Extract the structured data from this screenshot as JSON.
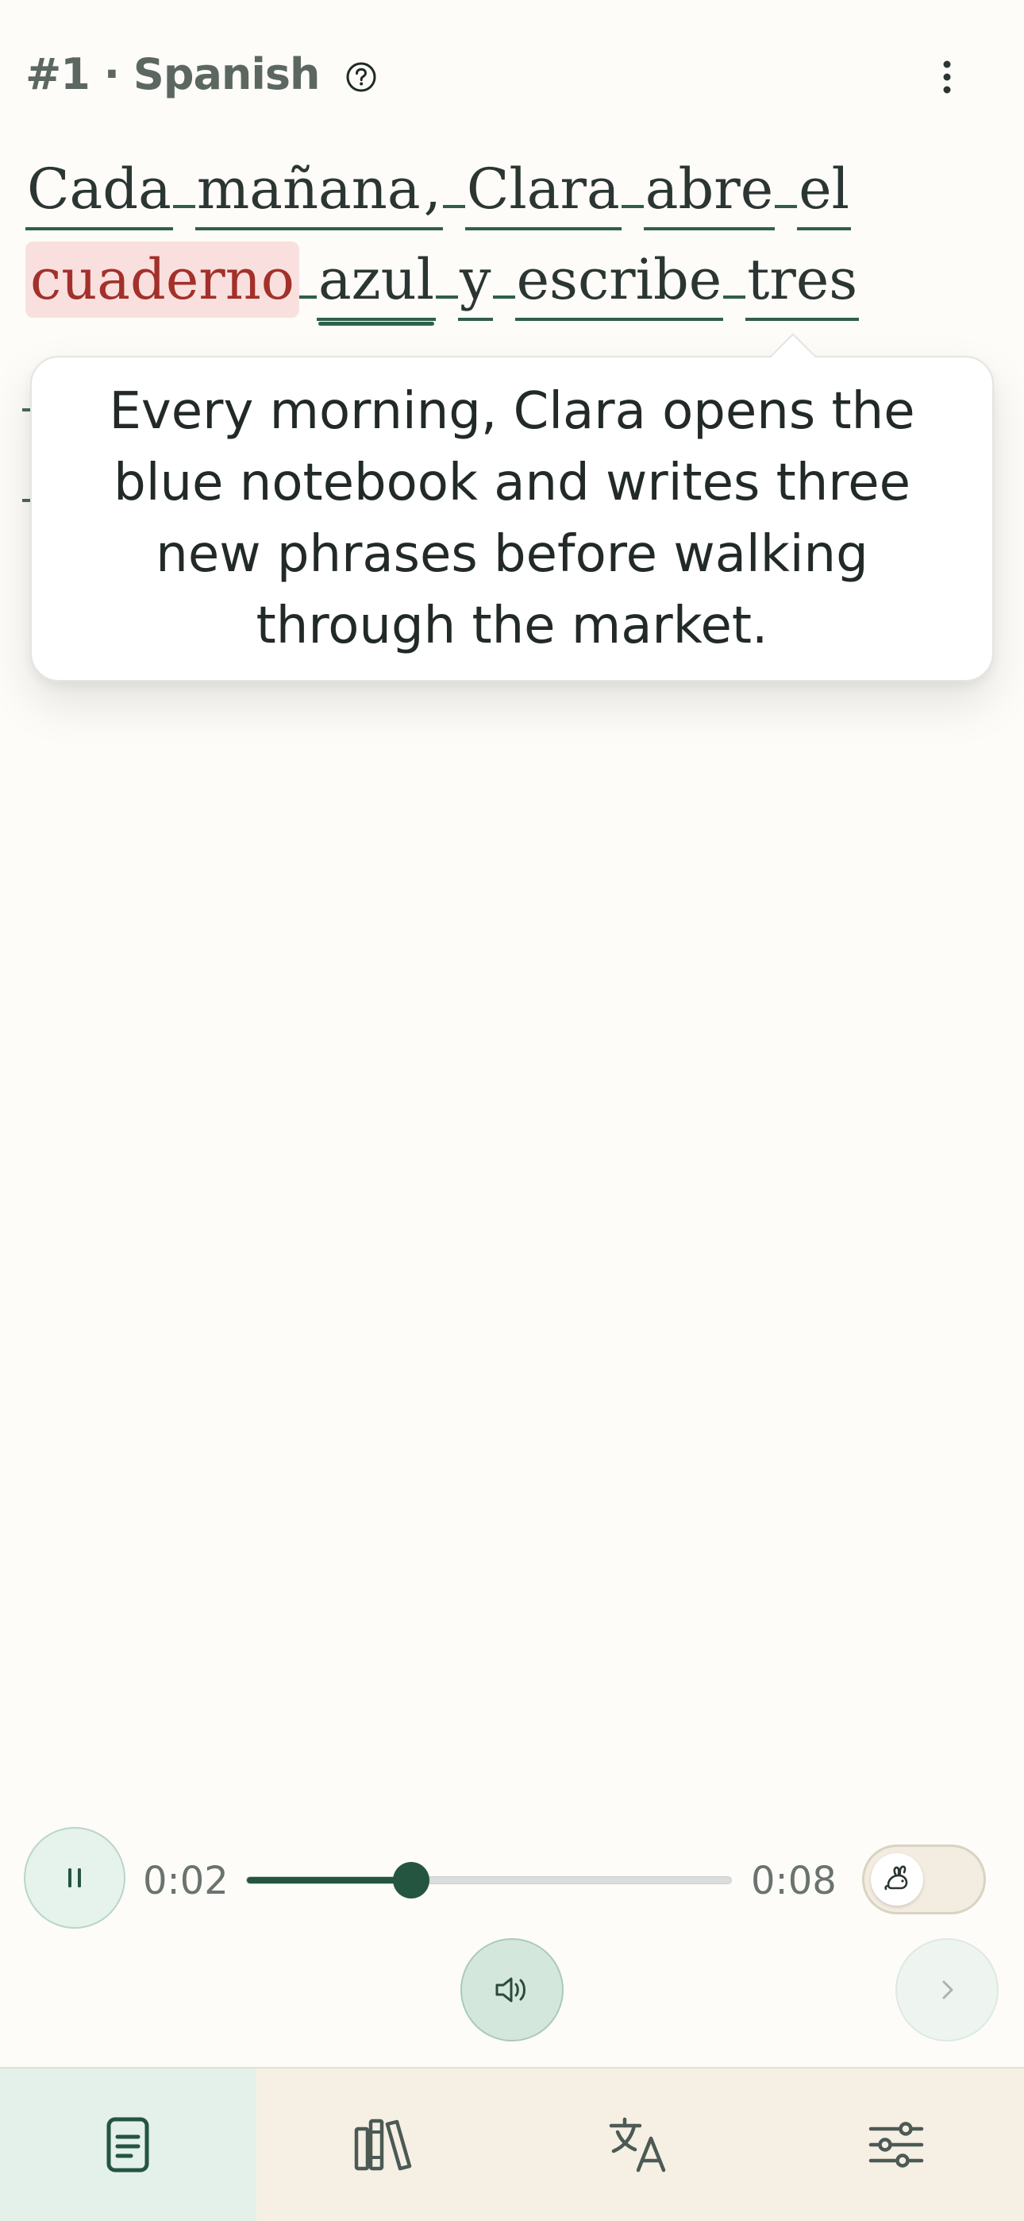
{
  "header": {
    "title": "#1 · Spanish",
    "help_icon": "question-circle-icon",
    "menu_icon": "more-vertical-icon"
  },
  "reading": {
    "line1": [
      "Cada",
      "mañana",
      ",",
      "Clara",
      "abre",
      "el"
    ],
    "line2": [
      "cuaderno",
      "azul",
      "y",
      "escribe",
      "tres"
    ],
    "active_word": "cuaderno"
  },
  "translation": {
    "text": "Every morning, Clara opens the blue notebook and writes three new phrases before walking through the market."
  },
  "player": {
    "current_time": "0:02",
    "total_time": "0:08",
    "progress_fraction": 0.34,
    "pause_icon": "pause-icon",
    "speed_icon": "rabbit-icon",
    "volume_icon": "volume-icon",
    "next_icon": "chevron-right-icon"
  },
  "nav": {
    "items": [
      {
        "name": "reader",
        "icon": "document-icon",
        "active": true
      },
      {
        "name": "library",
        "icon": "books-icon",
        "active": false
      },
      {
        "name": "translate",
        "icon": "translate-icon",
        "active": false
      },
      {
        "name": "settings",
        "icon": "sliders-icon",
        "active": false
      }
    ]
  },
  "colors": {
    "background": "#fdfcf8",
    "accent": "#245541",
    "highlight_bg": "#f9e0de",
    "highlight_text": "#a3302a",
    "nav_bg": "#f6efe4",
    "nav_active_bg": "#e3f1ea"
  }
}
